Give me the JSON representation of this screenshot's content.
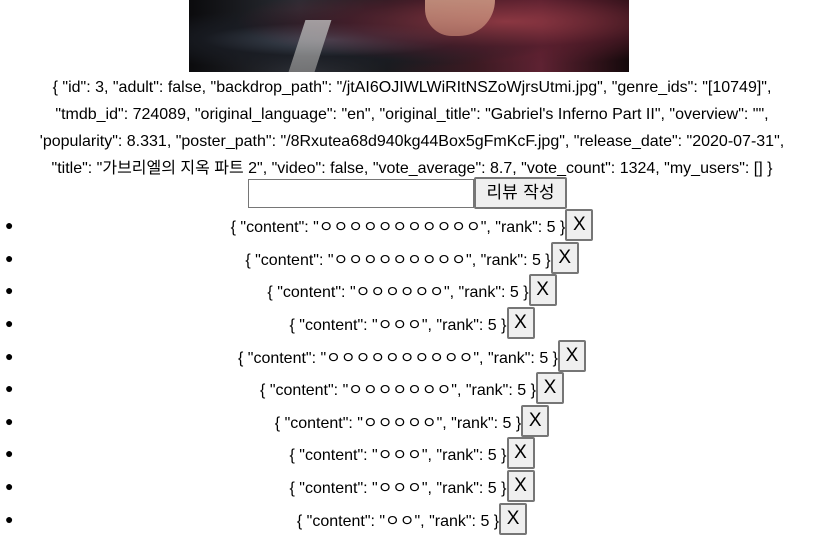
{
  "movie_info_text": "{ \"id\": 3, \"adult\": false, \"backdrop_path\": \"/jtAI6OJIWLWiRItNSZoWjrsUtmi.jpg\", \"genre_ids\": \"[10749]\",\n\"tmdb_id\": 724089, \"original_language\": \"en\", \"original_title\": \"Gabriel's Inferno Part II\", \"overview\": \"\",\n'popularity\": 8.331, \"poster_path\": \"/8Rxutea68d940kg44Box5gFmKcF.jpg\", \"release_date\": \"2020-07-31\",\n\"title\": \"가브리엘의 지옥 파트 2\", \"video\": false, \"vote_average\": 8.7, \"vote_count\": 1324, \"my_users\": [] }",
  "review_form": {
    "input_value": "",
    "submit_label": "리뷰 작성"
  },
  "reviews": [
    {
      "text": "{ \"content\": \"ㅇㅇㅇㅇㅇㅇㅇㅇㅇㅇㅇ\", \"rank\": 5 }",
      "delete_label": "X"
    },
    {
      "text": "{ \"content\": \"ㅇㅇㅇㅇㅇㅇㅇㅇㅇ\", \"rank\": 5 }",
      "delete_label": "X"
    },
    {
      "text": "{ \"content\": \"ㅇㅇㅇㅇㅇㅇ\", \"rank\": 5 }",
      "delete_label": "X"
    },
    {
      "text": "{ \"content\": \"ㅇㅇㅇ\", \"rank\": 5 }",
      "delete_label": "X"
    },
    {
      "text": "{ \"content\": \"ㅇㅇㅇㅇㅇㅇㅇㅇㅇㅇ\", \"rank\": 5 }",
      "delete_label": "X"
    },
    {
      "text": "{ \"content\": \"ㅇㅇㅇㅇㅇㅇㅇ\", \"rank\": 5 }",
      "delete_label": "X"
    },
    {
      "text": "{ \"content\": \"ㅇㅇㅇㅇㅇ\", \"rank\": 5 }",
      "delete_label": "X"
    },
    {
      "text": "{ \"content\": \"ㅇㅇㅇ\", \"rank\": 5 }",
      "delete_label": "X"
    },
    {
      "text": "{ \"content\": \"ㅇㅇㅇ\", \"rank\": 5 }",
      "delete_label": "X"
    },
    {
      "text": "{ \"content\": \"ㅇㅇ\", \"rank\": 5 }",
      "delete_label": "X"
    }
  ]
}
